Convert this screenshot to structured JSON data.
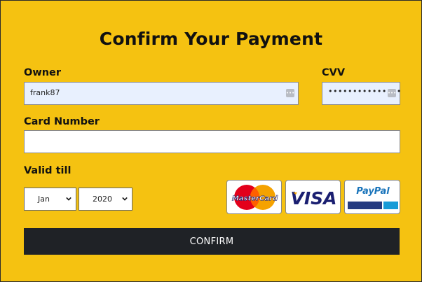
{
  "title": "Confirm Your Payment",
  "owner": {
    "label": "Owner",
    "value": "frank87"
  },
  "cvv": {
    "label": "CVV",
    "value": "•••••••••••••••"
  },
  "card_number": {
    "label": "Card Number",
    "value": ""
  },
  "valid_till": {
    "label": "Valid till",
    "month": "Jan",
    "year": "2020"
  },
  "payment_methods": [
    {
      "name": "mastercard-logo",
      "text": "MasterCard"
    },
    {
      "name": "visa-logo",
      "text": "VISA"
    },
    {
      "name": "paypal-logo",
      "text": "PayPal"
    }
  ],
  "confirm_button": "CONFIRM",
  "colors": {
    "background": "#f5c211",
    "button": "#1f2226",
    "autofill": "#e8f0fe"
  }
}
